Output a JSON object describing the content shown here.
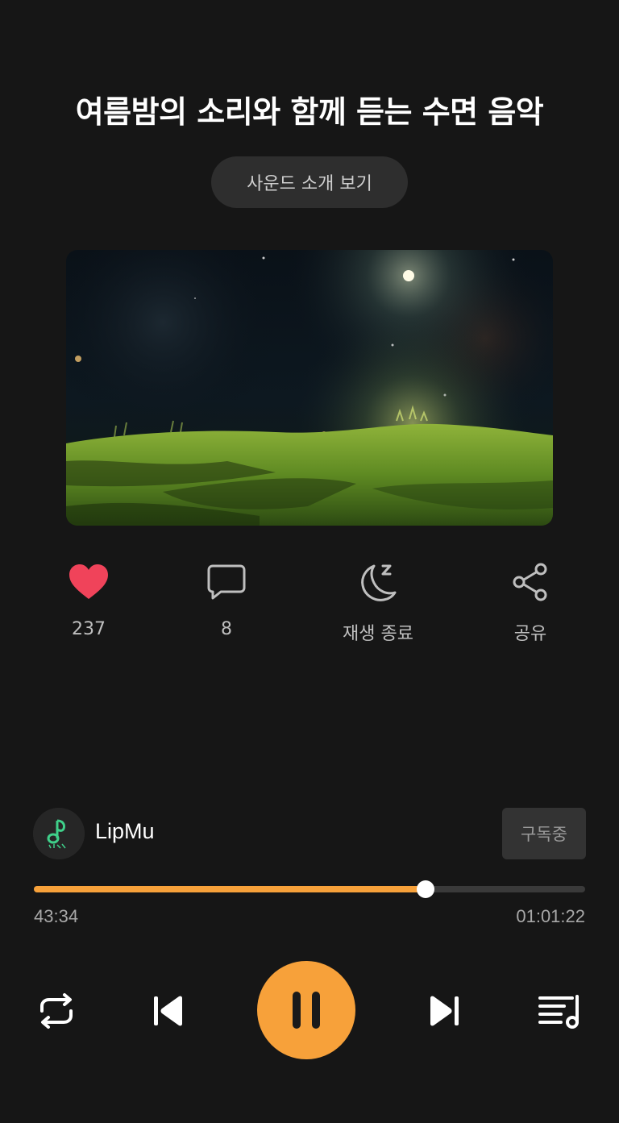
{
  "sound": {
    "title": "여름밤의 소리와 함께 듣는 수면 음악",
    "intro_button_label": "사운드 소개 보기"
  },
  "actions": {
    "like": {
      "count": "237",
      "icon": "heart-icon",
      "color": "#f0435a"
    },
    "comment": {
      "count": "8",
      "icon": "chat-bubble-icon"
    },
    "sleep_timer": {
      "label": "재생 종료",
      "icon": "moon-zzz-icon"
    },
    "share": {
      "label": "공유",
      "icon": "share-icon"
    }
  },
  "channel": {
    "name": "LipMu",
    "subscribe_label": "구독중"
  },
  "player": {
    "elapsed": "43:34",
    "total": "01:01:22",
    "progress_fraction": 0.71,
    "accent_color": "#f7a13a",
    "controls": [
      "repeat-icon",
      "previous-icon",
      "pause-icon",
      "next-icon",
      "playlist-icon"
    ]
  }
}
